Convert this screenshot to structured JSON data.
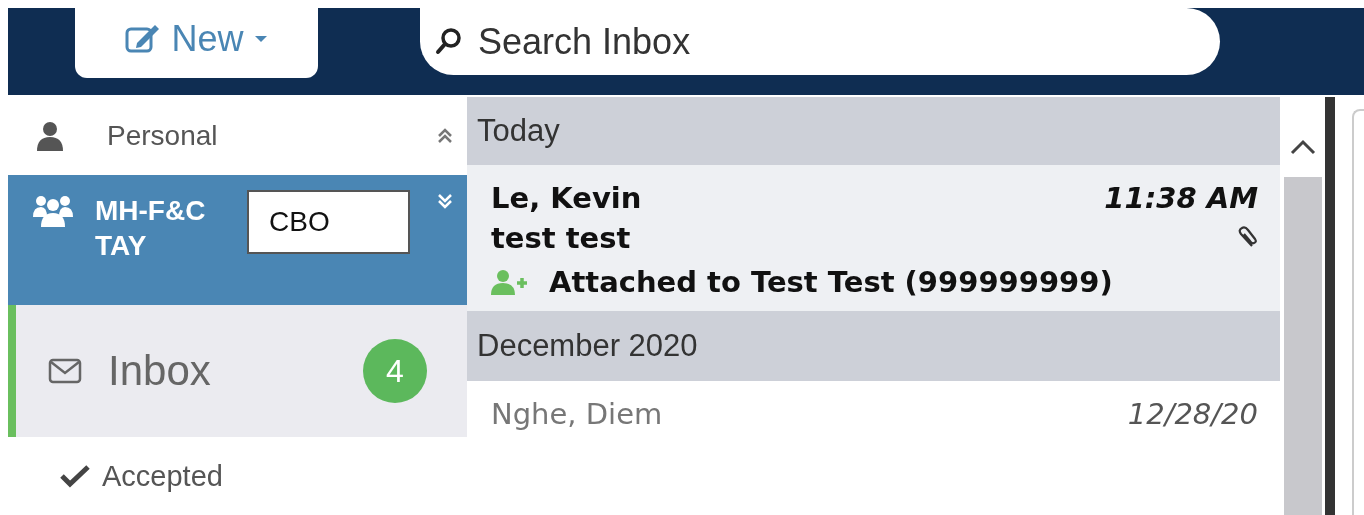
{
  "toolbar": {
    "new_button": {
      "label": "New"
    },
    "search": {
      "placeholder": "Search Inbox"
    }
  },
  "sidebar": {
    "items": [
      {
        "kind": "personal",
        "label": "Personal",
        "expanded": true,
        "selected": false
      },
      {
        "kind": "shared",
        "label": "MH-F&C TAY",
        "expanded": false,
        "selected": true
      },
      {
        "kind": "folder",
        "label": "Inbox",
        "count": "4",
        "selected": true
      },
      {
        "kind": "subfolder",
        "label": "Accepted",
        "selected": false
      }
    ]
  },
  "tooltip": {
    "text": "CBO"
  },
  "messages": [
    {
      "kind": "header",
      "label": "Today"
    },
    {
      "kind": "message",
      "sender": "Le, Kevin",
      "time": "11:38 AM",
      "subject": "test test",
      "attachment": true,
      "unread": true,
      "selected": true,
      "note": "Attached to Test Test (999999999)"
    },
    {
      "kind": "header",
      "label": "December 2020"
    },
    {
      "kind": "message",
      "sender": "Nghe, Diem",
      "time": "12/28/20",
      "unread": false,
      "selected": false
    }
  ]
}
